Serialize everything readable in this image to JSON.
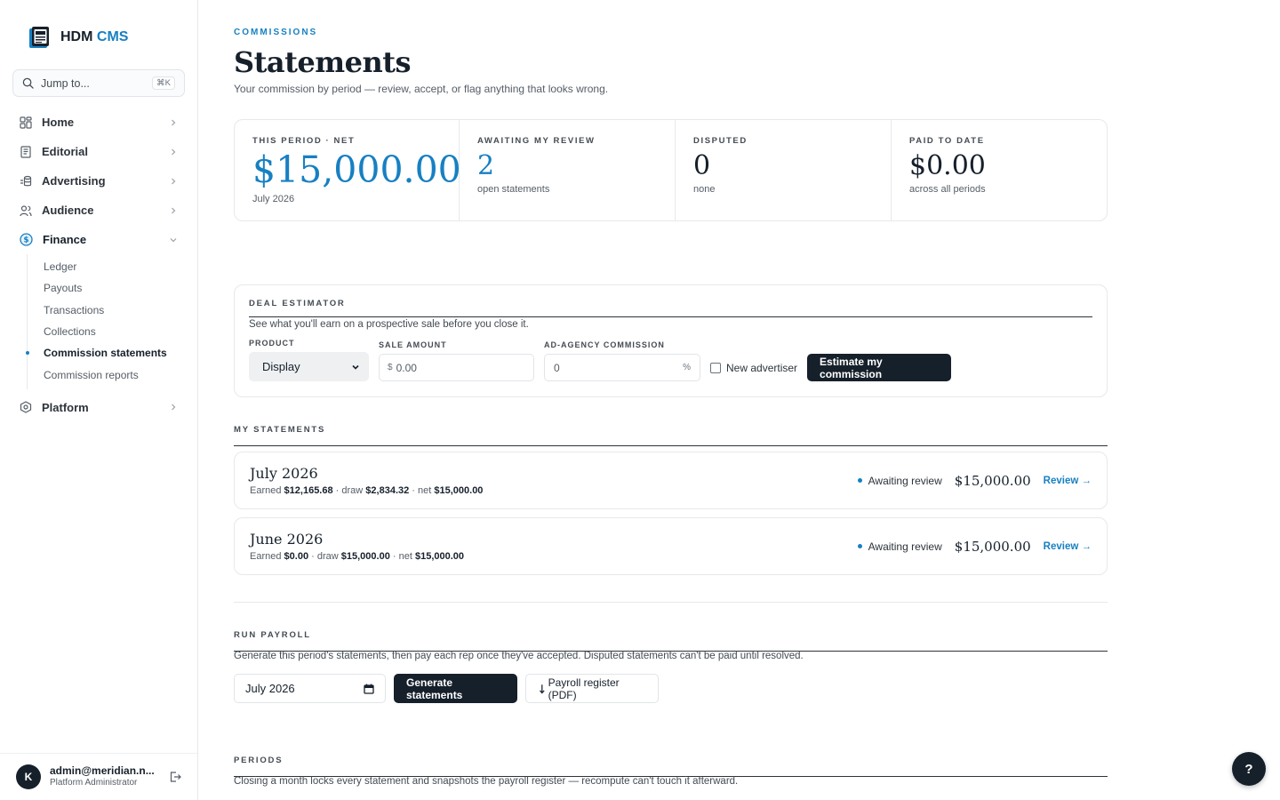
{
  "brand": {
    "name": "HDM",
    "accent": "CMS"
  },
  "search": {
    "placeholder": "Jump to...",
    "shortcut": "⌘K"
  },
  "nav": {
    "items": [
      {
        "label": "Home",
        "icon": "grid-icon"
      },
      {
        "label": "Editorial",
        "icon": "document-icon"
      },
      {
        "label": "Advertising",
        "icon": "coins-icon"
      },
      {
        "label": "Audience",
        "icon": "users-icon"
      },
      {
        "label": "Finance",
        "icon": "dollar-circle-icon"
      },
      {
        "label": "Platform",
        "icon": "hexagon-icon"
      }
    ],
    "finance_sub": [
      "Ledger",
      "Payouts",
      "Transactions",
      "Collections",
      "Commission statements",
      "Commission reports"
    ]
  },
  "user": {
    "initial": "K",
    "email": "admin@meridian.n...",
    "role": "Platform Administrator"
  },
  "page": {
    "eyebrow": "COMMISSIONS",
    "title": "Statements",
    "subtitle": "Your commission by period — review, accept, or flag anything that looks wrong."
  },
  "stats": [
    {
      "label": "THIS PERIOD · NET",
      "value": "$15,000.00",
      "sub": "July 2026"
    },
    {
      "label": "AWAITING MY REVIEW",
      "value": "2",
      "sub": "open statements"
    },
    {
      "label": "DISPUTED",
      "value": "0",
      "sub": "none"
    },
    {
      "label": "PAID TO DATE",
      "value": "$0.00",
      "sub": "across all periods"
    }
  ],
  "estimator": {
    "label": "DEAL ESTIMATOR",
    "desc": "See what you'll earn on a prospective sale before you close it.",
    "product_label": "PRODUCT",
    "product_value": "Display",
    "sale_label": "SALE AMOUNT",
    "sale_prefix": "$",
    "sale_placeholder": "0.00",
    "agency_label": "AD-AGENCY COMMISSION",
    "agency_value": "0",
    "agency_suffix": "%",
    "new_advertiser_label": "New advertiser",
    "button": "Estimate my commission"
  },
  "statements": {
    "label": "MY STATEMENTS",
    "rows": [
      {
        "period": "July 2026",
        "earned_label": "Earned",
        "earned": "$12,165.68",
        "draw_label": "draw",
        "draw": "$2,834.32",
        "net_label": "net",
        "net": "$15,000.00",
        "status": "Awaiting review",
        "amount": "$15,000.00",
        "action": "Review →"
      },
      {
        "period": "June 2026",
        "earned_label": "Earned",
        "earned": "$0.00",
        "draw_label": "draw",
        "draw": "$15,000.00",
        "net_label": "net",
        "net": "$15,000.00",
        "status": "Awaiting review",
        "amount": "$15,000.00",
        "action": "Review →"
      }
    ]
  },
  "payroll": {
    "label": "RUN PAYROLL",
    "desc": "Generate this period's statements, then pay each rep once they've accepted. Disputed statements can't be paid until resolved.",
    "month": "July 2026",
    "generate": "Generate statements",
    "register": "Payroll register (PDF)"
  },
  "periods": {
    "label": "PERIODS",
    "desc": "Closing a month locks every statement and snapshots the payroll register — recompute can't touch it afterward."
  },
  "help": "?",
  "colors": {
    "accent": "#1780c2",
    "dark": "#16202b"
  }
}
